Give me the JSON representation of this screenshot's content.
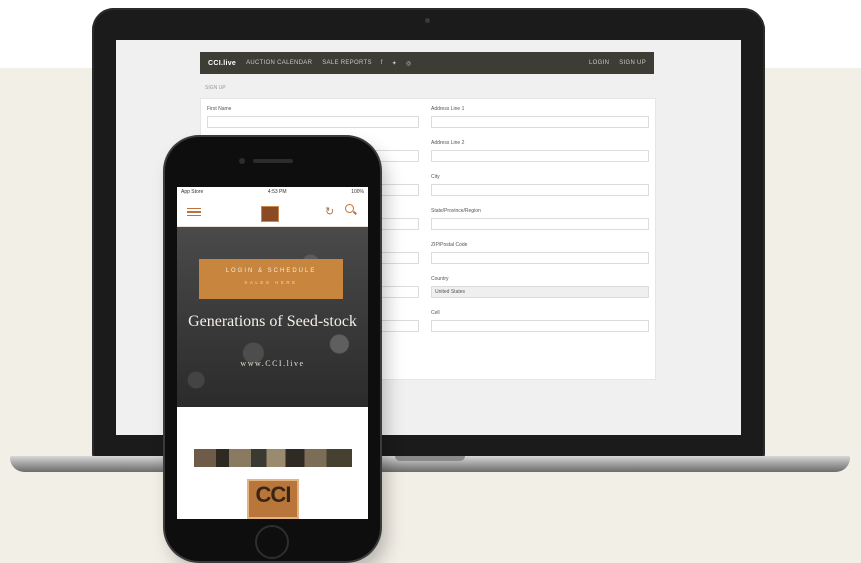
{
  "laptop": {
    "nav": {
      "logo": "CCI.live",
      "items": [
        "AUCTION CALENDAR",
        "SALE REPORTS"
      ],
      "icons": [
        "facebook-icon",
        "twitter-icon",
        "instagram-icon"
      ],
      "right": [
        "LOGIN",
        "SIGN UP"
      ]
    },
    "breadcrumb": "SIGN UP",
    "form": {
      "left_fields": [
        {
          "label": "First Name"
        }
      ],
      "right_fields": [
        {
          "label": "Address Line 1"
        },
        {
          "label": "Address Line 2"
        },
        {
          "label": "City"
        },
        {
          "label": "State/Province/Region"
        },
        {
          "label": "ZIP/Postal Code"
        },
        {
          "label": "Country",
          "value": "United States"
        },
        {
          "label": "Cell"
        }
      ]
    }
  },
  "phone": {
    "status": {
      "left": "App Store",
      "time": "4:53 PM",
      "right": "100%"
    },
    "hero": {
      "badge_line1": "LOGIN & SCHEDULE",
      "badge_line2": "SALES HERE",
      "title": "Generations of Seed-stock",
      "url": "www.CCI.live"
    },
    "logo_text": "CCI"
  },
  "colors": {
    "nav_bg": "#3d3d35",
    "accent": "#c8853e",
    "backdrop": "#f2efe6"
  }
}
